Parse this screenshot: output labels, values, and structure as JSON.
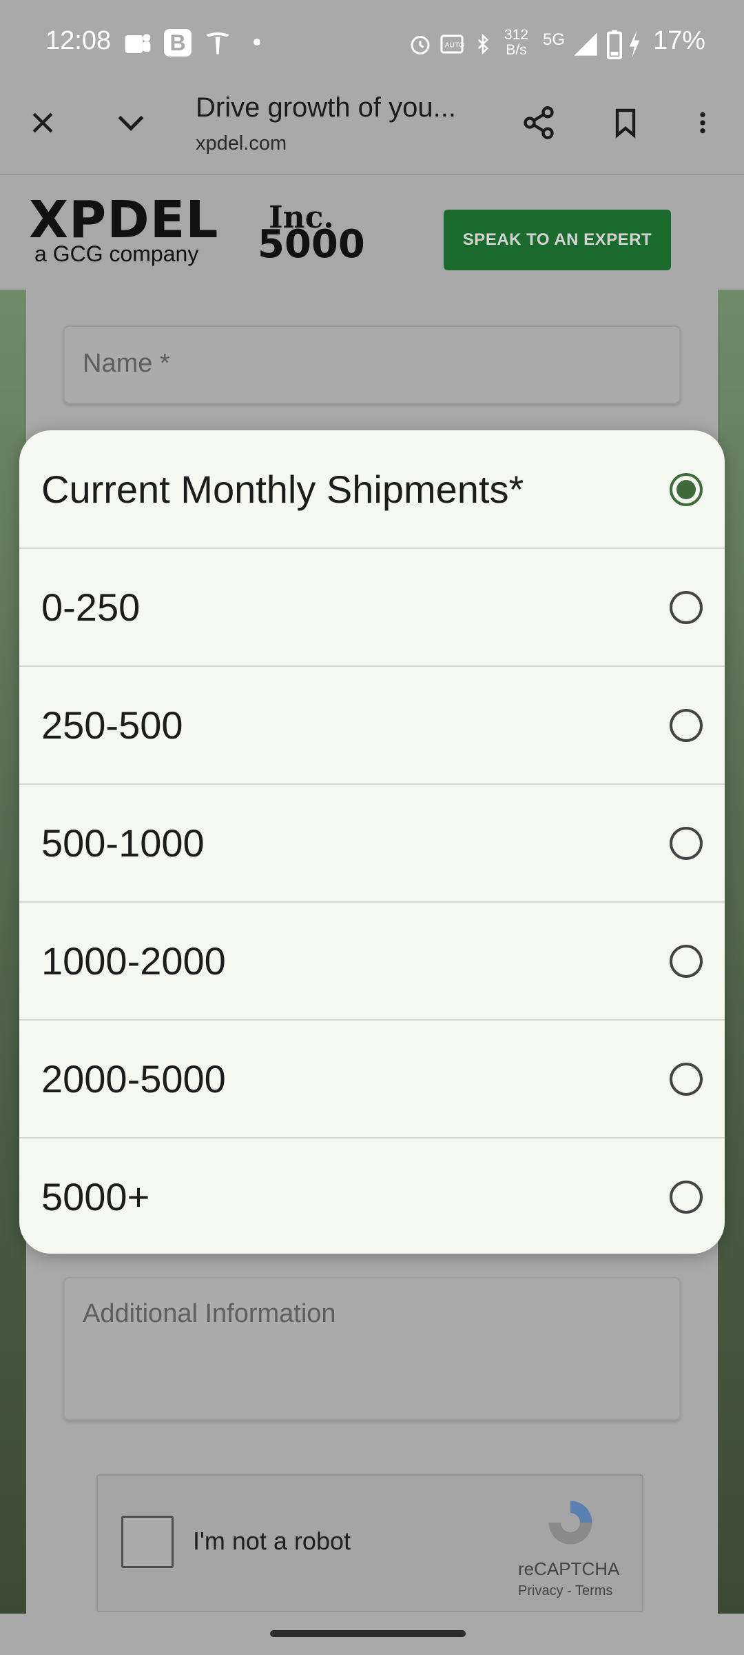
{
  "status_bar": {
    "time": "12:08",
    "net_speed_value": "312",
    "net_speed_unit": "B/s",
    "network": "5G",
    "battery": "17%",
    "icons": [
      "teams-icon",
      "b-app-icon",
      "tesla-icon",
      "dot-icon",
      "alarm-icon",
      "nfc-icon",
      "bluetooth-icon",
      "signal-icon",
      "battery-icon",
      "charging-icon"
    ]
  },
  "browser": {
    "title": "Drive growth of you...",
    "url": "xpdel.com"
  },
  "header": {
    "logo_main": "XPDEL",
    "logo_sub": "a GCG company",
    "inc_top": "Inc.",
    "inc_bottom": "5000",
    "cta": "SPEAK TO AN EXPERT"
  },
  "form": {
    "name_placeholder": "Name *",
    "additional_placeholder": "Additional Information",
    "captcha_label": "I'm not a robot",
    "captcha_brand": "reCAPTCHA",
    "captcha_links": "Privacy - Terms"
  },
  "dialog": {
    "options": [
      {
        "label": "Current Monthly Shipments*",
        "selected": true
      },
      {
        "label": "0-250",
        "selected": false
      },
      {
        "label": "250-500",
        "selected": false
      },
      {
        "label": "500-1000",
        "selected": false
      },
      {
        "label": "1000-2000",
        "selected": false
      },
      {
        "label": "2000-5000",
        "selected": false
      },
      {
        "label": "5000+",
        "selected": false
      }
    ]
  },
  "colors": {
    "accent": "#3f6a3c",
    "cta_bg": "#1c6b2e",
    "dialog_bg": "#f5f8f0"
  }
}
